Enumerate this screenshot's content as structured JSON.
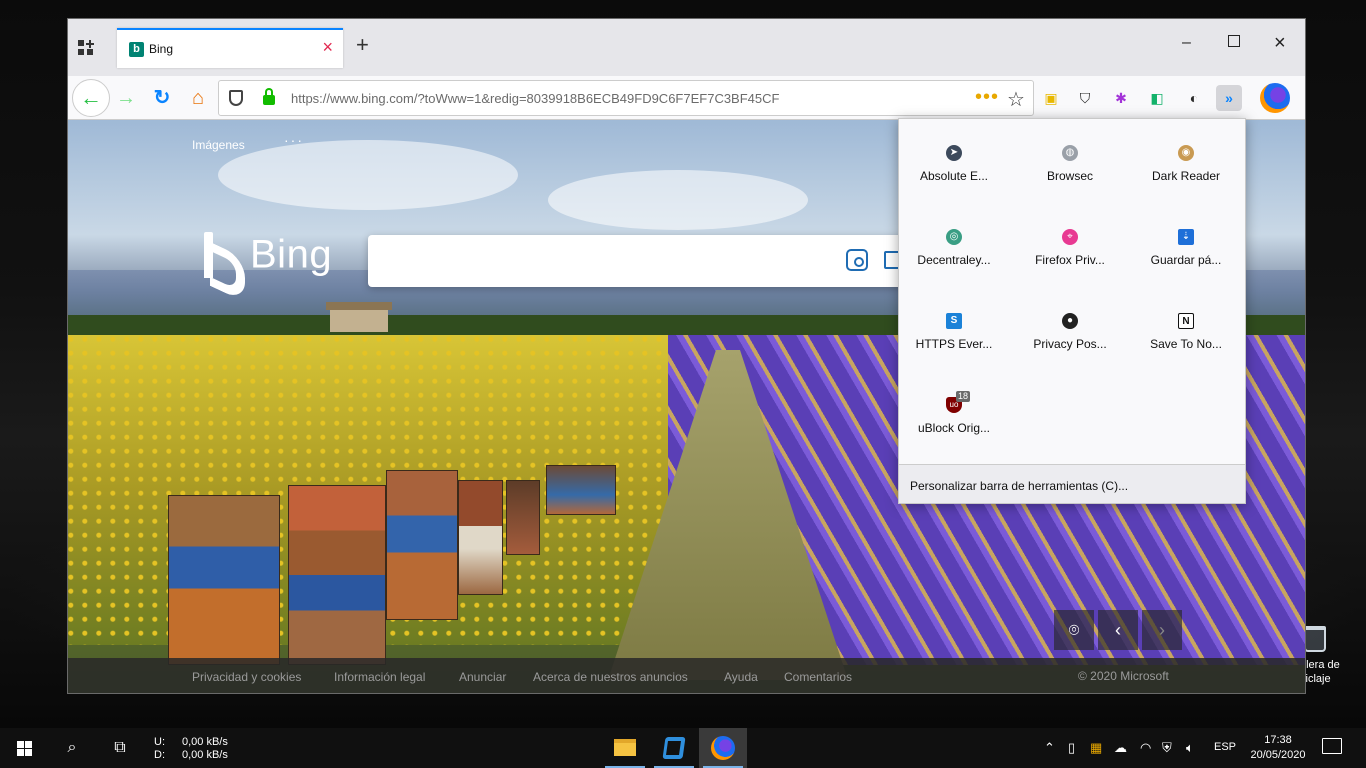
{
  "browser": {
    "tab": {
      "title": "Bing",
      "favicon_icon": "bing-icon"
    },
    "url": "https://www.bing.com/?toWww=1&redig=8039918B6ECB49FD9C6F7EF7C3BF45CF",
    "page_actions": "•••",
    "accent_color": "#0a84ff"
  },
  "bing": {
    "nav_images": "Imágenes",
    "nav_more": "···",
    "logo_text": "Bing",
    "footer": {
      "privacy": "Privacidad y cookies",
      "legal": "Información legal",
      "advertise": "Anunciar",
      "about_ads": "Acerca de nuestros anuncios",
      "help": "Ayuda",
      "feedback": "Comentarios",
      "copyright": "© 2020 Microsoft"
    }
  },
  "overflow_menu": {
    "items": [
      {
        "label": "Absolute E..."
      },
      {
        "label": "Browsec"
      },
      {
        "label": "Dark Reader"
      },
      {
        "label": "Decentraley..."
      },
      {
        "label": "Firefox Priv..."
      },
      {
        "label": "Guardar pá..."
      },
      {
        "label": "HTTPS Ever..."
      },
      {
        "label": "Privacy Pos..."
      },
      {
        "label": "Save To No..."
      },
      {
        "label": "uBlock Orig...",
        "badge": "18"
      }
    ],
    "customize": "Personalizar barra de herramientas (C)..."
  },
  "desktop": {
    "recycle_bin": "elera de\nciclaje"
  },
  "taskbar": {
    "upload_label": "U:",
    "upload_value": "0,00 kB/s",
    "download_label": "D:",
    "download_value": "0,00 kB/s",
    "language": "ESP",
    "time": "17:38",
    "date": "20/05/2020"
  }
}
